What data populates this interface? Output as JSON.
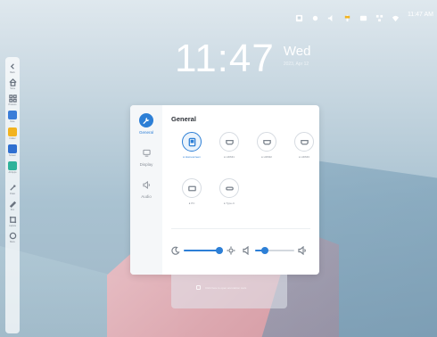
{
  "clock": {
    "time": "11:47",
    "day": "Wed",
    "date": "2023, Apr 12"
  },
  "statusbar": {
    "time": "11:47 AM",
    "icons": [
      "notes-icon",
      "brightness-icon",
      "volume-icon",
      "usb-icon",
      "screen-share-icon",
      "network-icon",
      "wifi-icon"
    ]
  },
  "sidebar": {
    "items": [
      {
        "name": "back",
        "label": "Back",
        "icon": "chevron-left-icon"
      },
      {
        "name": "home",
        "label": "Home",
        "icon": "home-icon"
      },
      {
        "name": "process",
        "label": "Process",
        "icon": "grid-icon"
      },
      {
        "name": "note",
        "label": "Note",
        "icon": "app-note",
        "color": "#3b7dd8"
      },
      {
        "name": "folder",
        "label": "Folder",
        "icon": "app-folder",
        "color": "#f2b320"
      },
      {
        "name": "screen",
        "label": "Screen",
        "icon": "app-screen",
        "color": "#2f6fd0"
      },
      {
        "name": "apps",
        "label": "All Apps",
        "icon": "app-grid",
        "color": "#2fb29a"
      },
      {
        "name": "draw",
        "label": "Draw",
        "icon": "pen-icon"
      },
      {
        "name": "pen",
        "label": "Pen",
        "icon": "pen2-icon"
      },
      {
        "name": "capture",
        "label": "Capture",
        "icon": "crop-icon"
      },
      {
        "name": "more",
        "label": "More",
        "icon": "more-icon"
      }
    ]
  },
  "panel": {
    "title": "General",
    "nav": [
      {
        "label": "General",
        "active": true
      },
      {
        "label": "Display",
        "active": false
      },
      {
        "label": "Audio",
        "active": false
      }
    ],
    "sources": [
      {
        "label": "● Homescreen",
        "active": true
      },
      {
        "label": "● HDMI1",
        "active": false
      },
      {
        "label": "● HDMI2",
        "active": false
      },
      {
        "label": "● HDMI3",
        "active": false
      },
      {
        "label": "● PC",
        "active": false
      },
      {
        "label": "● Type-C",
        "active": false
      }
    ],
    "brightness": {
      "value": 0.9
    },
    "volume": {
      "value": 0.25
    }
  },
  "under_card": {
    "text": "Click here to open annotation tools"
  },
  "colors": {
    "accent": "#2d7fd6"
  }
}
